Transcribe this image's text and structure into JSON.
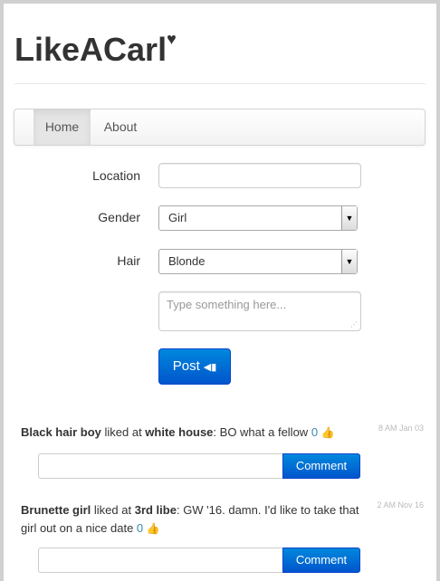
{
  "brand": {
    "title": "LikeACarl",
    "heart": "♥"
  },
  "nav": {
    "items": [
      {
        "label": "Home"
      },
      {
        "label": "About"
      }
    ]
  },
  "form": {
    "location_label": "Location",
    "location_value": "",
    "gender_label": "Gender",
    "gender_value": "Girl",
    "hair_label": "Hair",
    "hair_value": "Blonde",
    "message_placeholder": "Type something here...",
    "post_label": "Post"
  },
  "feed": [
    {
      "who": "Black hair boy",
      "liked_at": " liked at ",
      "place": "white house",
      "message": ": BO what a fellow ",
      "likes": "0",
      "timestamp": "8 AM Jan 03",
      "comment_label": "Comment"
    },
    {
      "who": "Brunette girl",
      "liked_at": " liked at ",
      "place": "3rd libe",
      "message": ": GW '16. damn. I'd like to take that girl out on a nice date ",
      "likes": "0",
      "timestamp": "2 AM Nov 16",
      "comment_label": "Comment"
    }
  ],
  "colors": {
    "primary": "#0066cc",
    "link": "#3a87ad"
  }
}
